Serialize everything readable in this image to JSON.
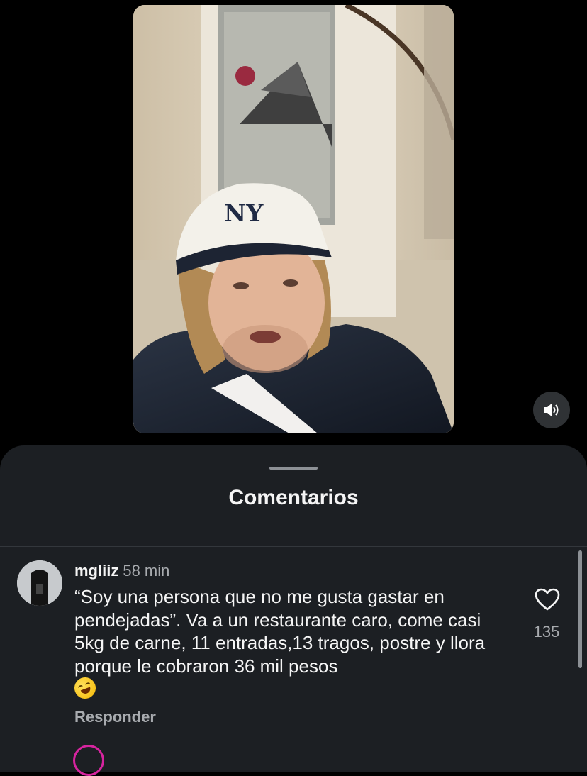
{
  "comments_sheet": {
    "title": "Comentarios",
    "comments": [
      {
        "username": "mgliiz",
        "time": "58 min",
        "text": "“Soy una persona que no me gusta gastar en pendejadas”. Va a un restaurante caro, come casi 5kg de carne, 11 entradas,13 tragos, postre y llora porque le cobraron 36 mil pesos",
        "emoji": "rolling-on-the-floor-laughing",
        "reply_label": "Responder",
        "like_count": "135",
        "like_icon": "heart-outline-icon"
      }
    ]
  },
  "video": {
    "mute_icon": "speaker-icon"
  },
  "colors": {
    "sheet_bg": "#1c1f23",
    "background": "#000000",
    "secondary_text": "#a8abaf"
  }
}
